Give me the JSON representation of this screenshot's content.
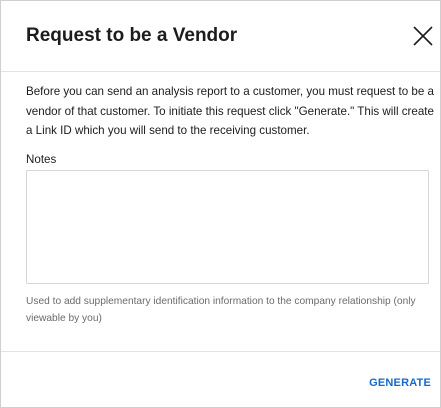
{
  "dialog": {
    "title": "Request to be a Vendor",
    "close_icon": "close-icon",
    "description": "Before you can send an analysis report to a customer, you must request to be a vendor of that customer. To initiate this request click \"Generate.\" This will create a Link ID which you will send to the receiving customer.",
    "notes": {
      "label": "Notes",
      "value": "",
      "placeholder": ""
    },
    "helper_text": "Used to add supplementary identification information to the company relationship (only viewable by you)",
    "generate_label": "GENERATE"
  },
  "colors": {
    "accent": "#1769c9",
    "title_text": "#1c1c1c",
    "helper_text": "#6b6b6b",
    "border": "#d6d6d6"
  }
}
